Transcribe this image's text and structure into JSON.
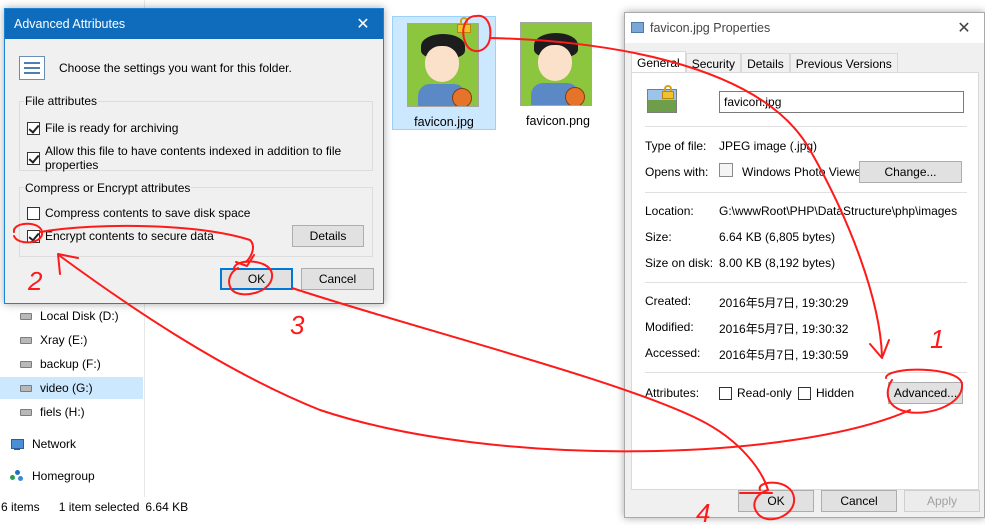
{
  "explorer": {
    "nav": [
      {
        "label": "Local Disk (D:)",
        "selected": false
      },
      {
        "label": "Xray (E:)",
        "selected": false
      },
      {
        "label": "backup (F:)",
        "selected": false
      },
      {
        "label": "video (G:)",
        "selected": true
      },
      {
        "label": "fiels (H:)",
        "selected": false
      }
    ],
    "network": "Network",
    "homegroup": "Homegroup",
    "files": [
      {
        "name": "favicon.jpg",
        "selected": true,
        "encrypted": true
      },
      {
        "name": "favicon.png",
        "selected": false,
        "encrypted": false
      }
    ],
    "status": {
      "items": "6 items",
      "selection": "1 item selected",
      "size": "6.64 KB"
    }
  },
  "advanced_dialog": {
    "title": "Advanced Attributes",
    "close": "✕",
    "intro": "Choose the settings you want for this folder.",
    "file_attributes": {
      "label": "File attributes",
      "archive": {
        "label": "File is ready for archiving",
        "checked": true
      },
      "index": {
        "label": "Allow this file to have contents indexed in addition to file properties",
        "checked": true
      }
    },
    "compress_encrypt": {
      "label": "Compress or Encrypt attributes",
      "compress": {
        "label": "Compress contents to save disk space",
        "checked": false
      },
      "encrypt": {
        "label": "Encrypt contents to secure data",
        "checked": true
      },
      "details_button": "Details"
    },
    "ok_button": "OK",
    "cancel_button": "Cancel"
  },
  "properties_dialog": {
    "title": "favicon.jpg Properties",
    "close": "✕",
    "tabs": [
      "General",
      "Security",
      "Details",
      "Previous Versions"
    ],
    "active_tab": "General",
    "filename": "favicon.jpg",
    "type_label": "Type of file:",
    "type_value": "JPEG image (.jpg)",
    "opens_label": "Opens with:",
    "opens_value": "Windows Photo Viewer",
    "change_button": "Change...",
    "location_label": "Location:",
    "location_value": "G:\\wwwRoot\\PHP\\DataStructure\\php\\images",
    "size_label": "Size:",
    "size_value": "6.64 KB (6,805 bytes)",
    "size_disk_label": "Size on disk:",
    "size_disk_value": "8.00 KB (8,192 bytes)",
    "created_label": "Created:",
    "created_value": "2016年5月7日, 19:30:29",
    "modified_label": "Modified:",
    "modified_value": "2016年5月7日, 19:30:32",
    "accessed_label": "Accessed:",
    "accessed_value": "2016年5月7日, 19:30:59",
    "attributes_label": "Attributes:",
    "readonly": {
      "label": "Read-only",
      "checked": false
    },
    "hidden": {
      "label": "Hidden",
      "checked": false
    },
    "advanced_button": "Advanced...",
    "ok_button": "OK",
    "cancel_button": "Cancel",
    "apply_button": "Apply"
  },
  "annotations": {
    "color": "#ff1a1a",
    "steps": [
      "1",
      "2",
      "3",
      "4"
    ]
  }
}
